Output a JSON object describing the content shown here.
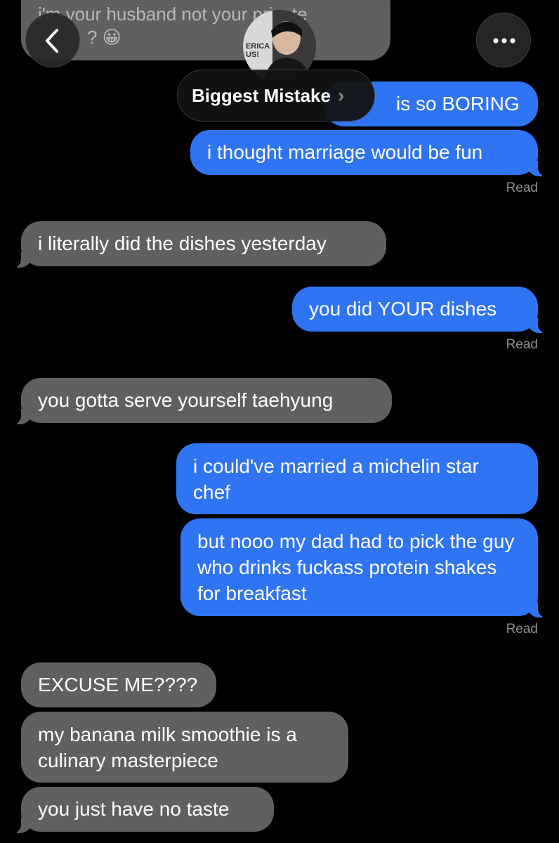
{
  "header": {
    "contact_name": "Biggest Mistake",
    "chevron": "›",
    "avatar_text": "ERICA\nUS!"
  },
  "messages": {
    "top_partial_line1": "i'm your husband not your private",
    "top_partial_line2": "? 😀",
    "boring_partial": "is so BORING",
    "m1": "i thought marriage would be fun",
    "r1": "Read",
    "m2": "i literally did the dishes yesterday",
    "m3": "you did YOUR dishes",
    "r2": "Read",
    "m4": "you gotta serve yourself taehyung",
    "m5": "i could've married a michelin star chef",
    "m6": "but nooo my dad had to pick the guy who drinks fuckass protein shakes for breakfast",
    "r3": "Read",
    "m7": "EXCUSE ME????",
    "m8": "my banana milk smoothie is a culinary masterpiece",
    "m9": "you just have no taste"
  },
  "colors": {
    "incoming": "#606062",
    "outgoing": "#2f74f3",
    "background": "#000000"
  }
}
